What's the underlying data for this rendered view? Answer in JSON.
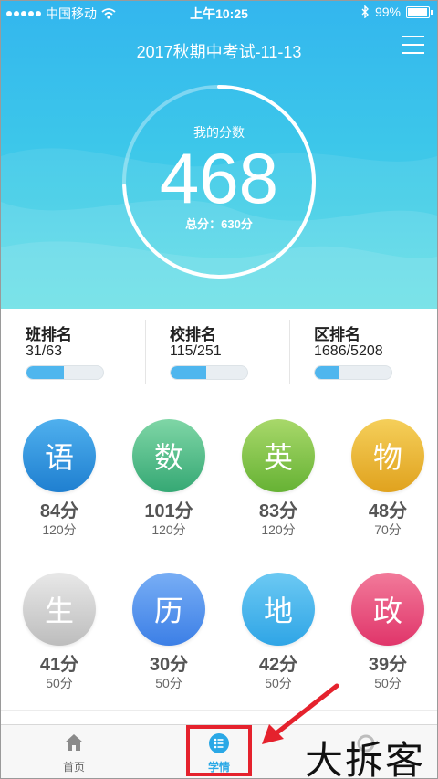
{
  "status_bar": {
    "carrier": "中国移动",
    "time": "上午10:25",
    "battery": "99%",
    "signal_icon": "signal-dots-icon",
    "wifi_icon": "wifi-icon",
    "bluetooth_icon": "bluetooth-icon",
    "battery_icon": "battery-icon"
  },
  "header": {
    "title": "2017秋期中考试-11-13",
    "menu_icon": "hamburger-menu-icon"
  },
  "score": {
    "label": "我的分数",
    "value": "468",
    "total": "总分：630分",
    "progress_fraction": 0.743
  },
  "rankings": [
    {
      "name": "班排名",
      "value": "31/63",
      "fraction": 0.49
    },
    {
      "name": "校排名",
      "value": "115/251",
      "fraction": 0.46
    },
    {
      "name": "区排名",
      "value": "1686/5208",
      "fraction": 0.32
    }
  ],
  "subjects": [
    {
      "char": "语",
      "score": "84分",
      "full": "120分",
      "color_top": "#4fb0ee",
      "color_bottom": "#1f7fd0"
    },
    {
      "char": "数",
      "score": "101分",
      "full": "120分",
      "color_top": "#7fd6a6",
      "color_bottom": "#35a874"
    },
    {
      "char": "英",
      "score": "83分",
      "full": "120分",
      "color_top": "#a8d86a",
      "color_bottom": "#66b234"
    },
    {
      "char": "物",
      "score": "48分",
      "full": "70分",
      "color_top": "#f5cf5a",
      "color_bottom": "#e0a21e"
    },
    {
      "char": "生",
      "score": "41分",
      "full": "50分",
      "color_top": "#e8e8e8",
      "color_bottom": "#bdbdbd"
    },
    {
      "char": "历",
      "score": "30分",
      "full": "50分",
      "color_top": "#78aef5",
      "color_bottom": "#3c7fe6"
    },
    {
      "char": "地",
      "score": "42分",
      "full": "50分",
      "color_top": "#6cc9f3",
      "color_bottom": "#2fa5e6"
    },
    {
      "char": "政",
      "score": "39分",
      "full": "50分",
      "color_top": "#f27a9a",
      "color_bottom": "#e0356a"
    }
  ],
  "tabs": [
    {
      "label": "首页",
      "icon": "home-icon",
      "active": false
    },
    {
      "label": "学情",
      "icon": "list-icon",
      "active": true
    }
  ],
  "overlay": {
    "watermark": "大拆客",
    "arrow_icon": "red-arrow-icon"
  },
  "colors": {
    "accent": "#2aa8e6",
    "highlight": "#e5222d"
  }
}
